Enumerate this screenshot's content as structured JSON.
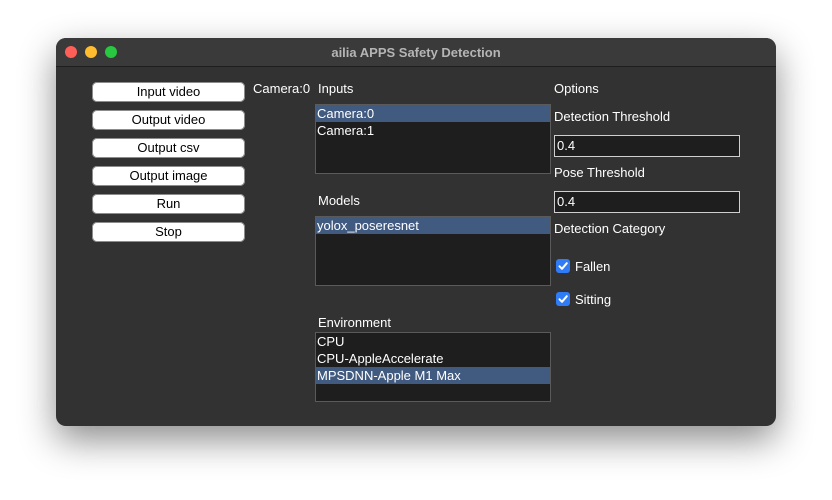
{
  "window": {
    "title": "ailia APPS Safety Detection"
  },
  "buttons": {
    "input_video": "Input video",
    "output_video": "Output video",
    "output_csv": "Output csv",
    "output_image": "Output image",
    "run": "Run",
    "stop": "Stop"
  },
  "camera_status": "Camera:0",
  "inputs": {
    "label": "Inputs",
    "items": [
      "Camera:0",
      "Camera:1"
    ],
    "selected": "Camera:0"
  },
  "models": {
    "label": "Models",
    "items": [
      "yolox_poseresnet"
    ],
    "selected": "yolox_poseresnet"
  },
  "environment": {
    "label": "Environment",
    "items": [
      "CPU",
      "CPU-AppleAccelerate",
      "MPSDNN-Apple M1 Max"
    ],
    "selected": "MPSDNN-Apple M1 Max"
  },
  "options": {
    "label": "Options",
    "detection_threshold_label": "Detection Threshold",
    "detection_threshold_value": "0.4",
    "pose_threshold_label": "Pose Threshold",
    "pose_threshold_value": "0.4",
    "detection_category_label": "Detection Category",
    "fallen_label": "Fallen",
    "fallen_checked": true,
    "sitting_label": "Sitting",
    "sitting_checked": true
  },
  "colors": {
    "selection": "#415a80",
    "checkbox": "#2f7cf6",
    "window_bg": "#323232"
  }
}
